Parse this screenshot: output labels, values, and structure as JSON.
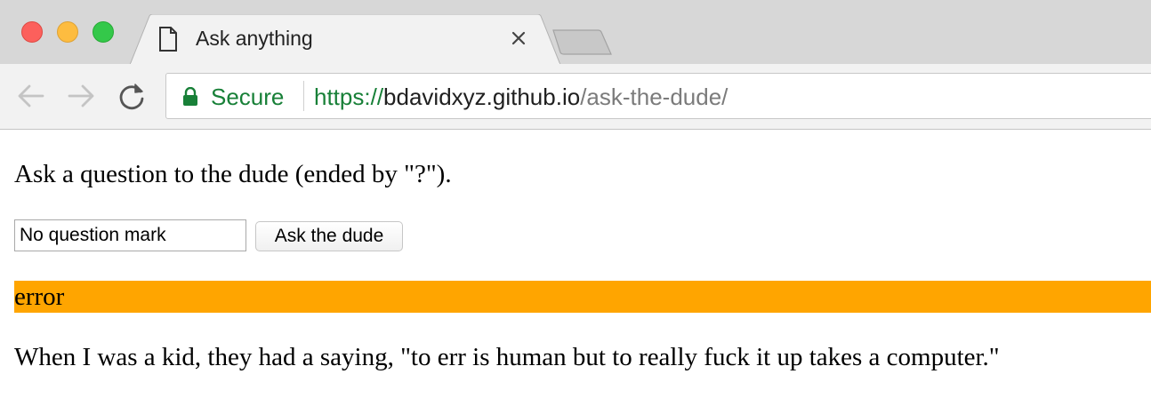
{
  "browser": {
    "tab": {
      "title": "Ask anything",
      "icon": "document-icon"
    },
    "address": {
      "secure_label": "Secure",
      "url_scheme": "https://",
      "url_host": "bdavidxyz.github.io",
      "url_path": "/ask-the-dude/"
    }
  },
  "page": {
    "prompt": "Ask a question to the dude (ended by \"?\").",
    "question_input": {
      "value": "No question mark"
    },
    "ask_button_label": "Ask the dude",
    "status": {
      "text": "error",
      "color": "#ffa500"
    },
    "answer": "When I was a kid, they had a saying, \"to err is human but to really fuck it up takes a computer.\""
  },
  "colors": {
    "secure_green": "#188038",
    "status_orange": "#ffa500"
  }
}
